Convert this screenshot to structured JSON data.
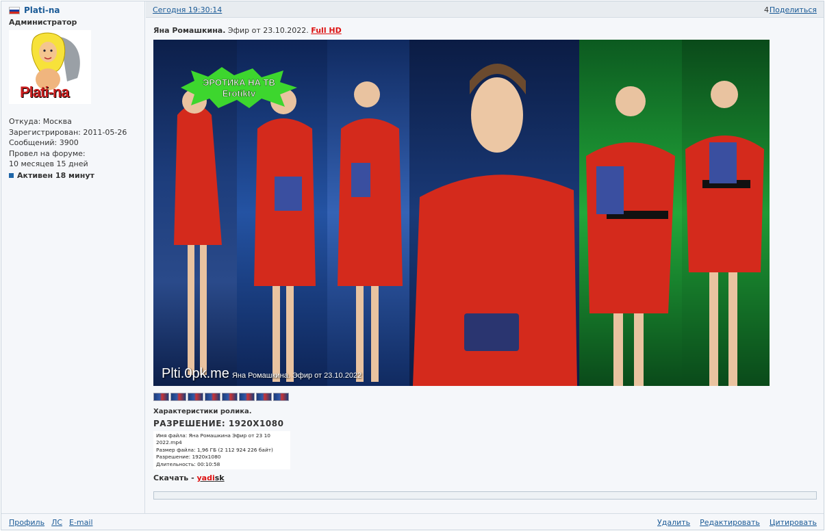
{
  "author": {
    "name": "Plati-na",
    "rank": "Администратор",
    "avatar_text": "Plati-na",
    "location": "Откуда: Москва",
    "registered": "Зарегистрирован: 2011-05-26",
    "messages": "Сообщений: 3900",
    "forum_time_label": "Провел на форуме:",
    "forum_time_value": "10 месяцев 15 дней",
    "active": "Активен 18 минут",
    "flag_colors": [
      "#ffffff",
      "#1c3f9e",
      "#d52b1e"
    ]
  },
  "header": {
    "time": "Сегодня 19:30:14",
    "post_number": "4",
    "share": "Поделиться"
  },
  "post": {
    "title_bold": "Яна Ромашкина.",
    "title_rest": " Эфир от 23.10.2022. ",
    "title_link": "Full HD",
    "image_watermark": "Plti.0pk.me",
    "image_caption": "Яна Ромашкина. Эфир от 23.10.2022",
    "logo_line1": "ЭРОТИКА НА ТВ",
    "logo_line2": "Erotiktv",
    "spec_title": "Характеристики ролика.",
    "spec_resolution": "РАЗРЕШЕНИЕ: 1920Х1080",
    "spec_lines": [
      "Имя файла: Яна Ромашкина Эфир от 23 10 2022.mp4",
      "Размер файла: 1,96 ГБ (2 112 924 226 байт)",
      "Разрешение: 1920x1080",
      "Длительность: 00:10:58"
    ],
    "download_label": "Скачать - ",
    "download_link_red": "yadi",
    "download_link_black": "sk"
  },
  "footer": {
    "left": [
      "Профиль",
      "ЛС",
      "E-mail"
    ],
    "right": [
      "Удалить",
      "Редактировать",
      "Цитировать"
    ]
  },
  "colors": {
    "link": "#1a5a96",
    "accent_red": "#dd1111",
    "dress_red": "#d42a1c"
  }
}
